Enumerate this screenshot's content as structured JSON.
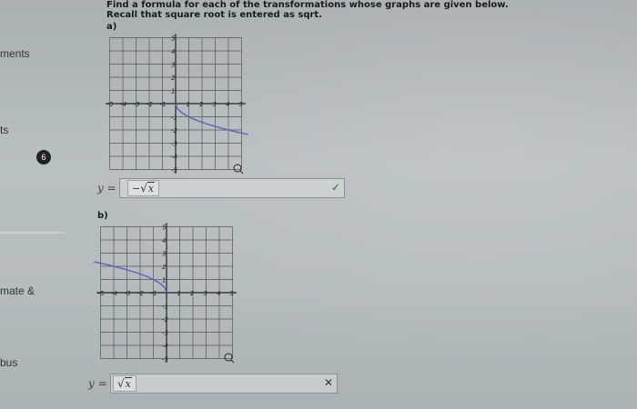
{
  "sidebar": {
    "items": [
      {
        "label": "ments"
      },
      {
        "label": "ts"
      },
      {
        "label": "mate &"
      },
      {
        "label": "bus"
      }
    ],
    "badge": "6"
  },
  "question": {
    "line1": "Find a formula for each of the transformations whose graphs are given below.",
    "line2": "Recall that square root is entered as sqrt."
  },
  "parts": [
    {
      "label": "a)",
      "answer_prefix": "y =",
      "answer_sign": "−",
      "answer_radicand": "x",
      "status": "correct",
      "status_icon": "checkmark-icon",
      "status_glyph": "✓"
    },
    {
      "label": "b)",
      "answer_prefix": "y =",
      "answer_sign": "",
      "answer_radicand": "x",
      "status": "incorrect",
      "status_icon": "x-mark-icon",
      "status_glyph": "✕"
    }
  ],
  "graph_ticks": {
    "x": [
      "-5",
      "-4",
      "-3",
      "-2",
      "-1",
      "1",
      "2",
      "3",
      "4",
      "5"
    ],
    "y": [
      "5",
      "4",
      "3",
      "2",
      "1",
      "-1",
      "-2",
      "-3",
      "-4",
      "-5"
    ]
  },
  "colors": {
    "curve": "#5b63b5",
    "grid": "#555555",
    "correct": "#2a6e2a",
    "incorrect": "#222222"
  }
}
